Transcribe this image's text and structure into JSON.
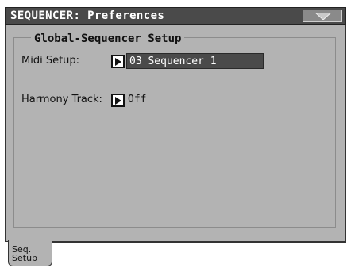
{
  "window": {
    "title": "SEQUENCER: Preferences",
    "menu_icon": "triangle-down-icon"
  },
  "group": {
    "title": "Global-Sequencer Setup"
  },
  "midi_setup": {
    "label": "Midi Setup:",
    "value": "03 Sequencer 1"
  },
  "harmony_track": {
    "label": "Harmony Track:",
    "value": "Off"
  },
  "tabs": [
    {
      "line1": "Seq.",
      "line2": "Setup",
      "active": true
    }
  ],
  "colors": {
    "titlebar": "#4a4a4a",
    "panel": "#b3b3b3",
    "selected_field": "#4a4a4a"
  }
}
